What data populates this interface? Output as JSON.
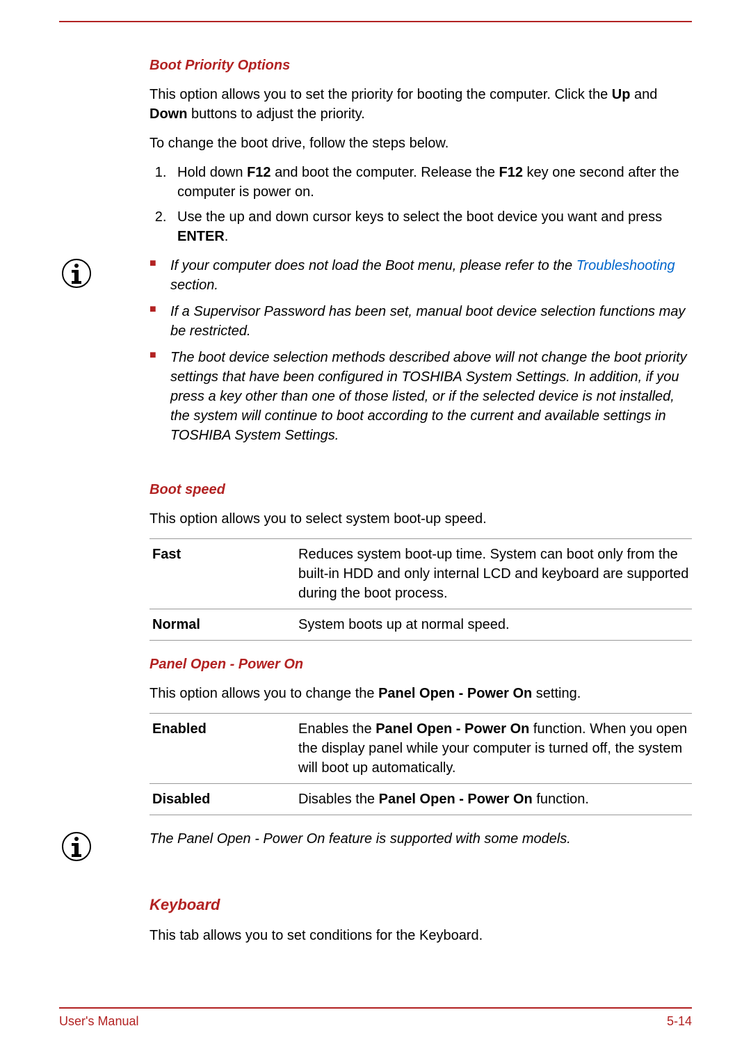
{
  "sections": {
    "boot_priority": {
      "heading": "Boot Priority Options",
      "p1_pre": "This option allows you to set the priority for booting the computer. Click the ",
      "p1_b1": "Up",
      "p1_mid": " and ",
      "p1_b2": "Down",
      "p1_post": " buttons to adjust the priority.",
      "p2": "To change the boot drive, follow the steps below.",
      "step1_pre": "Hold down ",
      "step1_b1": "F12",
      "step1_mid": " and boot the computer. Release the ",
      "step1_b2": "F12",
      "step1_post": " key one second after the computer is power on.",
      "step2_pre": "Use the up and down cursor keys to select the boot device you want and press ",
      "step2_b1": "ENTER",
      "step2_post": ".",
      "note1_pre": "If your computer does not load the Boot menu, please refer to the ",
      "note1_link": "Troubleshooting",
      "note1_post": " section.",
      "note2": "If a Supervisor Password has been set, manual boot device selection functions may be restricted.",
      "note3": "The boot device selection methods described above will not change the boot priority settings that have been configured in TOSHIBA System Settings. In addition, if you press a key other than one of those listed, or if the selected device is not installed, the system will continue to boot according to the current and available settings in TOSHIBA System Settings."
    },
    "boot_speed": {
      "heading": "Boot speed",
      "desc": "This option allows you to select system boot-up speed.",
      "rows": [
        {
          "label": "Fast",
          "desc": "Reduces system boot-up time. System can boot only from the built-in HDD and only internal LCD and keyboard are supported during the boot process."
        },
        {
          "label": "Normal",
          "desc": "System boots up at normal speed."
        }
      ]
    },
    "panel_open": {
      "heading": "Panel Open - Power On",
      "desc_pre": "This option allows you to change the ",
      "desc_b": "Panel Open - Power On",
      "desc_post": " setting.",
      "row1_label": "Enabled",
      "row1_pre": "Enables the ",
      "row1_b": "Panel Open - Power On",
      "row1_post": " function. When you open the display panel while your computer is turned off, the system will boot up automatically.",
      "row2_label": "Disabled",
      "row2_pre": "Disables the ",
      "row2_b": "Panel Open - Power On",
      "row2_post": " function.",
      "note": "The Panel Open - Power On feature is supported with some models."
    },
    "keyboard": {
      "heading": "Keyboard",
      "desc": "This tab allows you to set conditions for the Keyboard."
    }
  },
  "footer": {
    "left": "User's Manual",
    "right": "5-14"
  }
}
